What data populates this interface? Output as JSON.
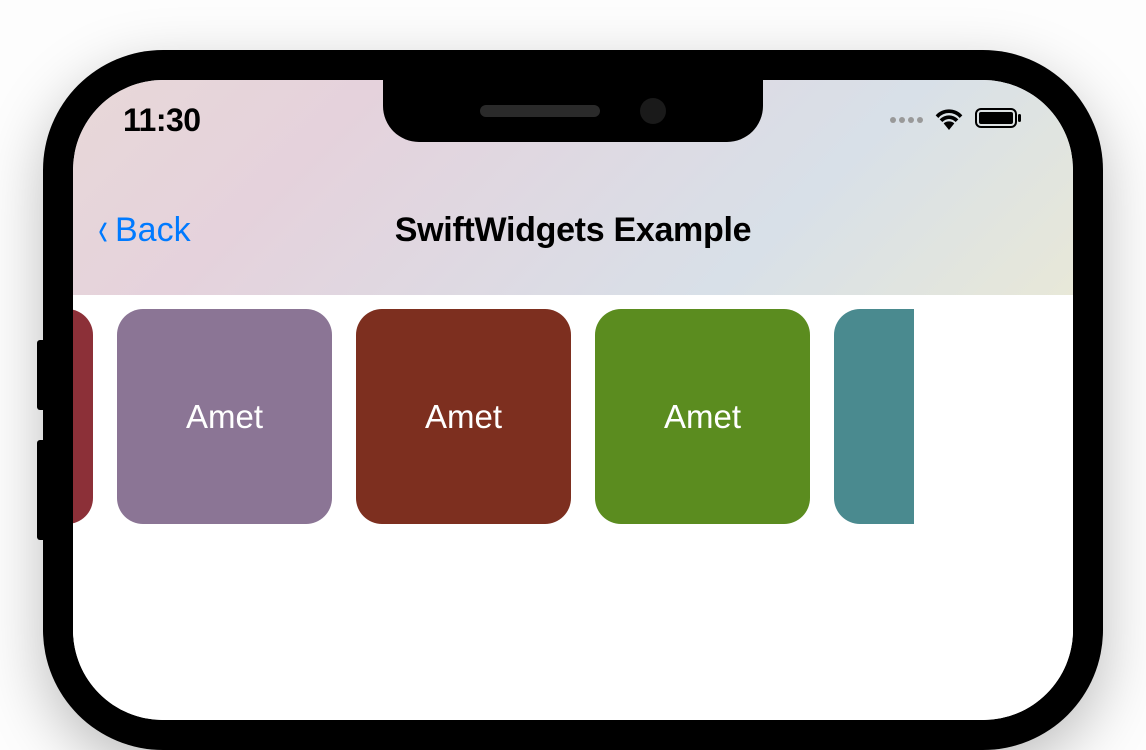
{
  "status": {
    "time": "11:30"
  },
  "nav": {
    "back_label": "Back",
    "title": "SwiftWidgets Example"
  },
  "cards": [
    {
      "label": "",
      "color": "#8c3038"
    },
    {
      "label": "Amet",
      "color": "#8b7595"
    },
    {
      "label": "Amet",
      "color": "#7d2f1f"
    },
    {
      "label": "Amet",
      "color": "#5b8c1f"
    },
    {
      "label": "",
      "color": "#4a8a8f"
    }
  ]
}
